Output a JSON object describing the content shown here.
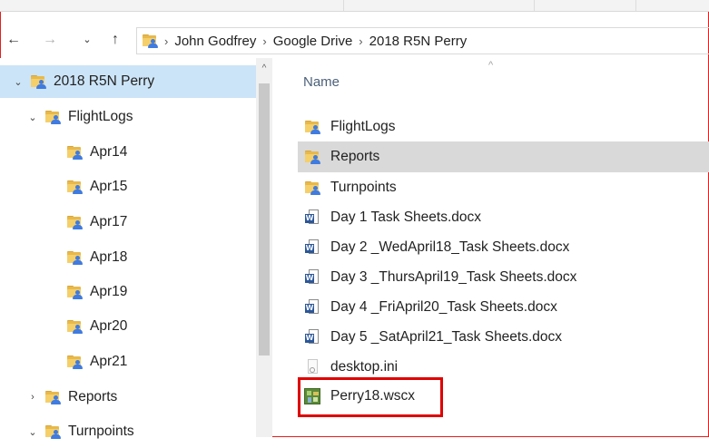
{
  "breadcrumb": {
    "items": [
      "John Godfrey",
      "Google Drive",
      "2018 R5N Perry"
    ]
  },
  "nav_pane": {
    "items": [
      {
        "label": "2018 R5N Perry",
        "level": 0,
        "expanded": true,
        "selected": true
      },
      {
        "label": "FlightLogs",
        "level": 1,
        "expanded": true,
        "selected": false
      },
      {
        "label": "Apr14",
        "level": 2,
        "expanded": false,
        "selected": false
      },
      {
        "label": "Apr15",
        "level": 2,
        "expanded": false,
        "selected": false
      },
      {
        "label": "Apr17",
        "level": 2,
        "expanded": false,
        "selected": false
      },
      {
        "label": "Apr18",
        "level": 2,
        "expanded": false,
        "selected": false
      },
      {
        "label": "Apr19",
        "level": 2,
        "expanded": false,
        "selected": false
      },
      {
        "label": "Apr20",
        "level": 2,
        "expanded": false,
        "selected": false
      },
      {
        "label": "Apr21",
        "level": 2,
        "expanded": false,
        "selected": false
      },
      {
        "label": "Reports",
        "level": 1,
        "expanded": false,
        "selected": false
      },
      {
        "label": "Turnpoints",
        "level": 1,
        "expanded": true,
        "selected": false
      }
    ]
  },
  "content": {
    "column_header": "Name",
    "files": [
      {
        "name": "FlightLogs",
        "type": "shared-folder",
        "selected": false
      },
      {
        "name": "Reports",
        "type": "shared-folder",
        "selected": true
      },
      {
        "name": "Turnpoints",
        "type": "shared-folder",
        "selected": false
      },
      {
        "name": "Day 1 Task Sheets.docx",
        "type": "word-doc",
        "selected": false
      },
      {
        "name": "Day 2 _WedApril18_Task Sheets.docx",
        "type": "word-doc",
        "selected": false
      },
      {
        "name": "Day 3 _ThursApril19_Task Sheets.docx",
        "type": "word-doc",
        "selected": false
      },
      {
        "name": "Day 4 _FriApril20_Task Sheets.docx",
        "type": "word-doc",
        "selected": false
      },
      {
        "name": "Day 5 _SatApril21_Task Sheets.docx",
        "type": "word-doc",
        "selected": false
      },
      {
        "name": "desktop.ini",
        "type": "ini-file",
        "selected": false
      },
      {
        "name": "Perry18.wscx",
        "type": "wscx-file",
        "selected": false,
        "highlighted": true
      }
    ]
  },
  "colors": {
    "highlight": "#e00000",
    "tree_selected": "#cce4f7",
    "row_selected": "#d9d9d9",
    "folder": "#f5cf6a",
    "shared_person": "#3f7be0",
    "word": "#2b579a"
  },
  "icons": {
    "back": "back-arrow-icon",
    "forward": "forward-arrow-icon",
    "recent": "chevron-down-icon",
    "up": "up-arrow-icon",
    "shared_folder": "shared-folder-icon",
    "word_doc": "word-document-icon",
    "ini": "settings-file-icon",
    "wscx": "wscx-file-icon"
  }
}
